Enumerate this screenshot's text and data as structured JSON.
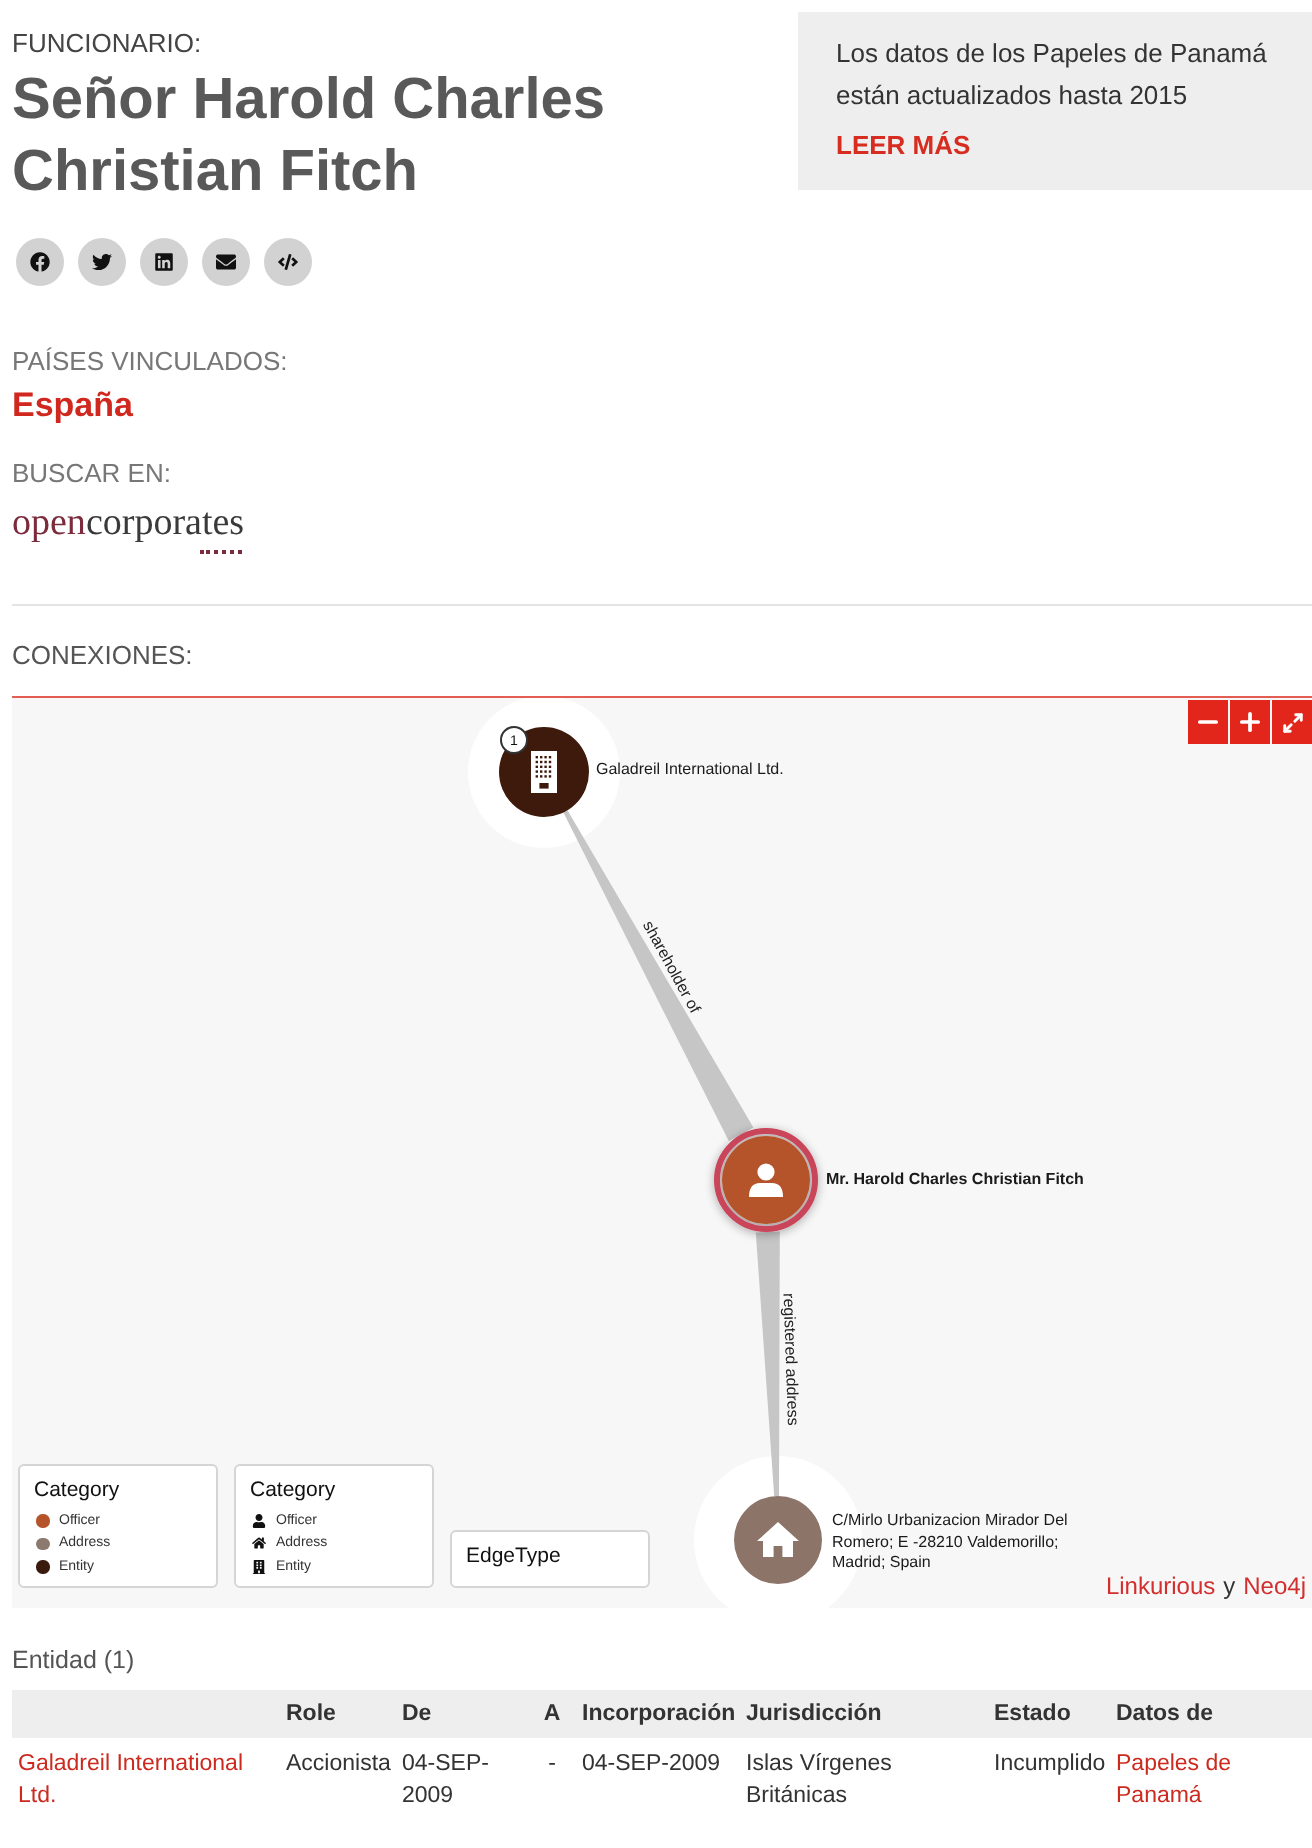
{
  "header": {
    "eyebrow": "FUNCIONARIO:",
    "title": "Señor Harold Charles Christian Fitch",
    "share_buttons": [
      {
        "kind": "facebook"
      },
      {
        "kind": "twitter"
      },
      {
        "kind": "linkedin"
      },
      {
        "kind": "email"
      },
      {
        "kind": "embed"
      }
    ]
  },
  "notice": {
    "text": "Los datos de los Papeles de Panamá están actualizados hasta 2015",
    "link": "LEER MÁS"
  },
  "linked_countries": {
    "label": "PAÍSES VINCULADOS:",
    "countries": [
      "España"
    ]
  },
  "search_in": {
    "label": "BUSCAR EN:",
    "source": {
      "prefix": "open",
      "suffix": "corporates"
    }
  },
  "connections": {
    "label": "CONEXIONES:",
    "zoom_controls": [
      {
        "kind": "zoom-out"
      },
      {
        "kind": "zoom-in"
      },
      {
        "kind": "fullscreen"
      }
    ],
    "nodes": [
      {
        "kind": "entity",
        "label": "Galadreil International Ltd.",
        "badge": "1",
        "selected": false
      },
      {
        "kind": "officer",
        "label": "Mr. Harold Charles Christian Fitch",
        "selected": true
      },
      {
        "kind": "address",
        "label": "C/Mirlo Urbanizacion Mirador Del Romero; E -28210 Valdemorillo; Madrid; Spain",
        "selected": false
      }
    ],
    "edges": [
      {
        "label": "shareholder of"
      },
      {
        "label": "registered address"
      }
    ],
    "legends": [
      {
        "title": "Category",
        "kind": "color",
        "items": [
          {
            "label": "Officer",
            "color": "#b5532a"
          },
          {
            "label": "Address",
            "color": "#8c7a70"
          },
          {
            "label": "Entity",
            "color": "#3b1a0e"
          }
        ]
      },
      {
        "title": "Category",
        "kind": "icon",
        "items": [
          {
            "label": "Officer",
            "kind": "person"
          },
          {
            "label": "Address",
            "kind": "house"
          },
          {
            "label": "Entity",
            "kind": "building"
          }
        ]
      },
      {
        "title": "EdgeType",
        "kind": "empty"
      }
    ],
    "credit": {
      "first": "Linkurious",
      "joiner": "y",
      "second": "Neo4j"
    }
  },
  "table": {
    "title": "Entidad (1)",
    "columns": [
      "",
      "Role",
      "De",
      "A",
      "Incorporación",
      "Jurisdicción",
      "Estado",
      "Datos de"
    ],
    "rows": [
      {
        "cells": [
          {
            "kind": "link",
            "text": "Galadreil International Ltd."
          },
          {
            "kind": "text",
            "text": "Accionista"
          },
          {
            "kind": "text",
            "text": "04-SEP-2009"
          },
          {
            "kind": "text",
            "text": "-"
          },
          {
            "kind": "text",
            "text": "04-SEP-2009"
          },
          {
            "kind": "text",
            "text": "Islas Vírgenes Británicas"
          },
          {
            "kind": "text",
            "text": "Incumplido"
          },
          {
            "kind": "link",
            "text": "Papeles de Panamá"
          }
        ]
      }
    ]
  }
}
